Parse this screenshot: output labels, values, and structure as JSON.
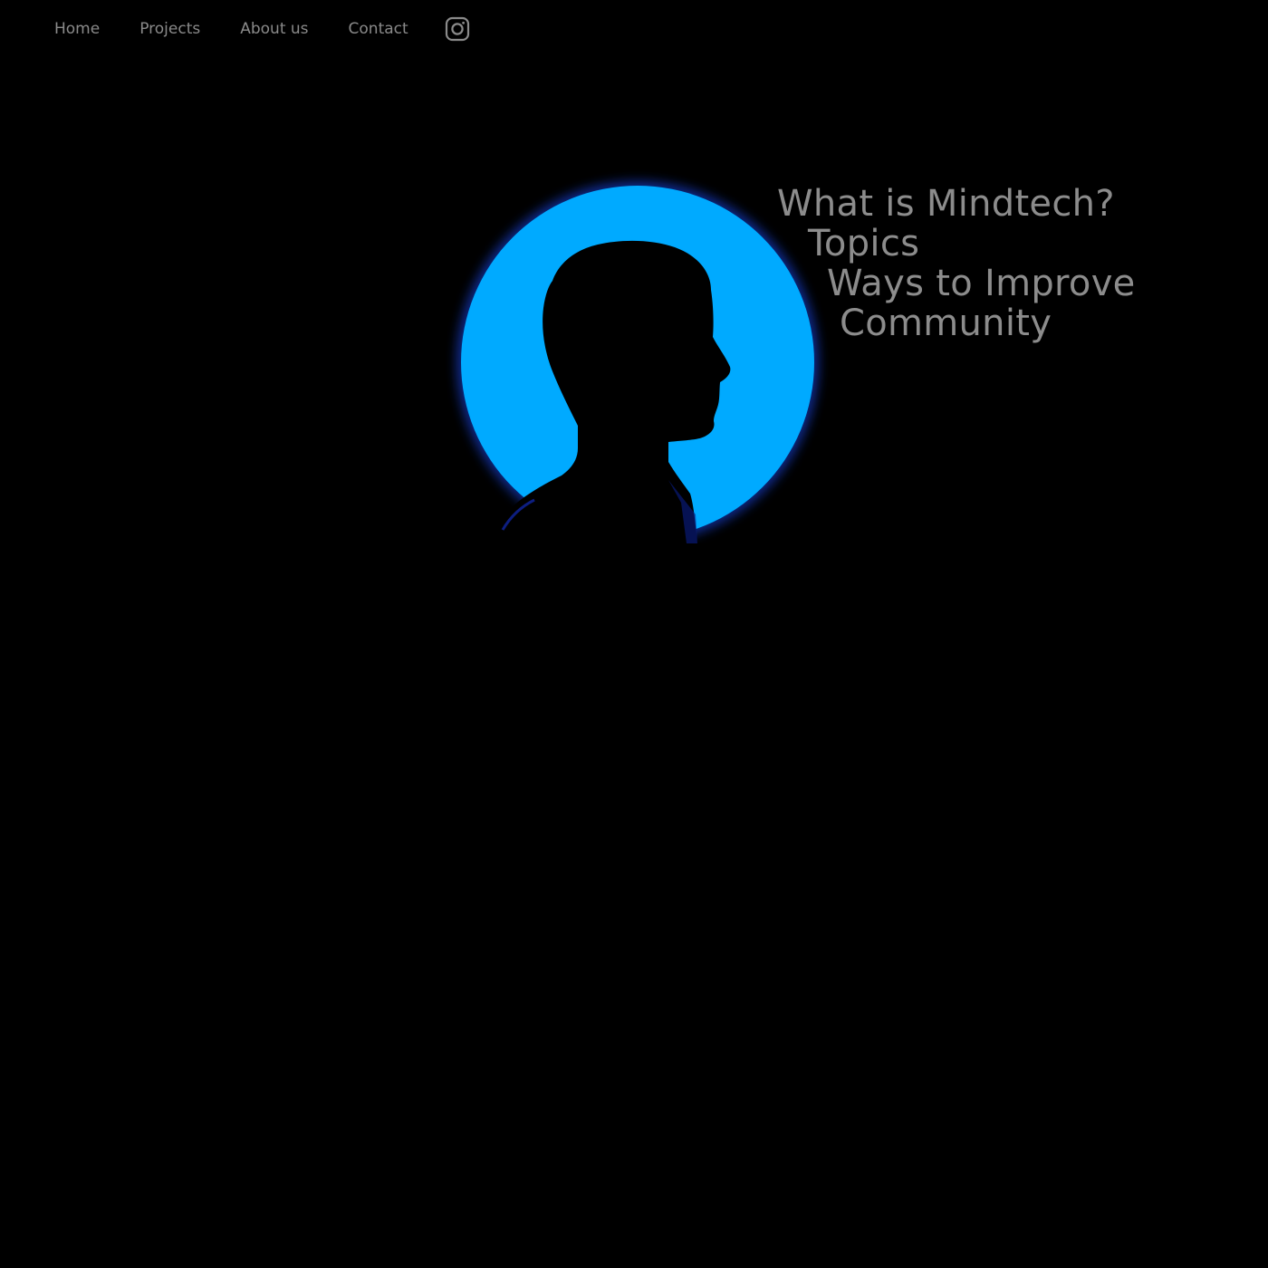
{
  "nav": {
    "items": [
      {
        "label": "Home"
      },
      {
        "label": "Projects"
      },
      {
        "label": "About us"
      },
      {
        "label": "Contact"
      }
    ],
    "social_icon": "instagram-icon"
  },
  "hero": {
    "image": "silhouette-blue-circle-image",
    "links": [
      {
        "label": "What is Mindtech?"
      },
      {
        "label": "Topics"
      },
      {
        "label": "Ways to Improve"
      },
      {
        "label": "Community"
      }
    ]
  },
  "colors": {
    "background": "#000000",
    "text": "#8c8c8c",
    "glow": "#00aaff"
  }
}
